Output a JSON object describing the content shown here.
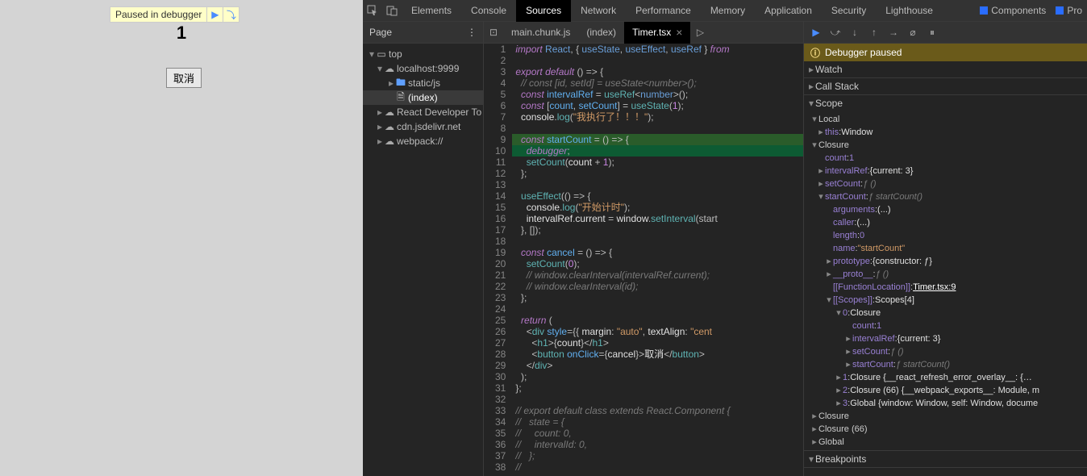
{
  "viewport": {
    "paused_text": "Paused in debugger",
    "counter": "1",
    "cancel_label": "取消"
  },
  "devtools": {
    "tabs": [
      "Elements",
      "Console",
      "Sources",
      "Network",
      "Performance",
      "Memory",
      "Application",
      "Security",
      "Lighthouse"
    ],
    "active_tab": "Sources",
    "extensions": [
      "Components",
      "Pro"
    ]
  },
  "left": {
    "header": "Page",
    "tree": {
      "top": "top",
      "host": "localhost:9999",
      "static": "static/js",
      "index": "(index)",
      "others": [
        "React Developer To",
        "cdn.jsdelivr.net",
        "webpack://"
      ]
    }
  },
  "file_tabs": {
    "items": [
      "main.chunk.js",
      "(index)",
      "Timer.tsx"
    ],
    "active": "Timer.tsx"
  },
  "code": {
    "lines": [
      {
        "n": 1,
        "html": "<span class='tok-keyword'>import</span> <span class='tok-import'>React</span><span class='tok-punct'>, { </span><span class='tok-import'>useState</span><span class='tok-punct'>, </span><span class='tok-import'>useEffect</span><span class='tok-punct'>, </span><span class='tok-import'>useRef</span><span class='tok-punct'> } </span><span class='tok-keyword'>from</span>"
      },
      {
        "n": 2,
        "html": ""
      },
      {
        "n": 3,
        "html": "<span class='tok-keyword'>export</span> <span class='tok-keyword'>default</span> <span class='tok-punct'>() =&gt; {</span>"
      },
      {
        "n": 4,
        "html": "  <span class='tok-comment'>// const [id, setId] = useState&lt;number&gt;();</span>"
      },
      {
        "n": 5,
        "html": "  <span class='tok-keyword'>const</span> <span class='tok-var'>intervalRef</span> <span class='tok-punct'>=</span> <span class='tok-func'>useRef</span><span class='tok-punct'>&lt;</span><span class='tok-type'>number</span><span class='tok-punct'>&gt;();</span>"
      },
      {
        "n": 6,
        "html": "  <span class='tok-keyword'>const</span> <span class='tok-punct'>[</span><span class='tok-var'>count</span><span class='tok-punct'>, </span><span class='tok-var'>setCount</span><span class='tok-punct'>] = </span><span class='tok-func'>useState</span><span class='tok-punct'>(</span><span class='tok-num'>1</span><span class='tok-punct'>);</span>"
      },
      {
        "n": 7,
        "html": "  <span class='tok-default'>console</span><span class='tok-punct'>.</span><span class='tok-func'>log</span><span class='tok-punct'>(</span><span class='tok-string'>\"我执行了！！！\"</span><span class='tok-punct'>);</span>"
      },
      {
        "n": 8,
        "html": ""
      },
      {
        "n": 9,
        "html": "  <span class='tok-keyword'>const</span> <span class='tok-var'>startCount</span> <span class='tok-punct'>= () =&gt; {</span>",
        "cls": "hl-break"
      },
      {
        "n": 10,
        "html": "    <span class='tok-keyword'>debugger</span><span class='tok-punct'>;</span>",
        "cls": "hl-break2"
      },
      {
        "n": 11,
        "html": "    <span class='tok-func'>setCount</span><span class='tok-punct'>(</span><span class='tok-default'>count</span> <span class='tok-punct'>+</span> <span class='tok-num'>1</span><span class='tok-punct'>);</span>"
      },
      {
        "n": 12,
        "html": "  <span class='tok-punct'>};</span>"
      },
      {
        "n": 13,
        "html": ""
      },
      {
        "n": 14,
        "html": "  <span class='tok-func'>useEffect</span><span class='tok-punct'>(() =&gt; {</span>"
      },
      {
        "n": 15,
        "html": "    <span class='tok-default'>console</span><span class='tok-punct'>.</span><span class='tok-func'>log</span><span class='tok-punct'>(</span><span class='tok-string'>\"开始计时\"</span><span class='tok-punct'>);</span>"
      },
      {
        "n": 16,
        "html": "    <span class='tok-default'>intervalRef</span><span class='tok-punct'>.</span><span class='tok-default'>current</span> <span class='tok-punct'>=</span> <span class='tok-default'>window</span><span class='tok-punct'>.</span><span class='tok-func'>setInterval</span><span class='tok-punct'>(start</span>"
      },
      {
        "n": 17,
        "html": "  <span class='tok-punct'>}, []);</span>"
      },
      {
        "n": 18,
        "html": ""
      },
      {
        "n": 19,
        "html": "  <span class='tok-keyword'>const</span> <span class='tok-var'>cancel</span> <span class='tok-punct'>= () =&gt; {</span>"
      },
      {
        "n": 20,
        "html": "    <span class='tok-func'>setCount</span><span class='tok-punct'>(</span><span class='tok-num'>0</span><span class='tok-punct'>);</span>"
      },
      {
        "n": 21,
        "html": "    <span class='tok-comment'>// window.clearInterval(intervalRef.current);</span>"
      },
      {
        "n": 22,
        "html": "    <span class='tok-comment'>// window.clearInterval(id);</span>"
      },
      {
        "n": 23,
        "html": "  <span class='tok-punct'>};</span>"
      },
      {
        "n": 24,
        "html": ""
      },
      {
        "n": 25,
        "html": "  <span class='tok-keyword'>return</span> <span class='tok-punct'>(</span>"
      },
      {
        "n": 26,
        "html": "    <span class='tok-punct'>&lt;</span><span class='tok-tag'>div</span> <span class='tok-attr'>style</span><span class='tok-punct'>={{ </span><span class='tok-default'>margin</span><span class='tok-punct'>: </span><span class='tok-string'>\"auto\"</span><span class='tok-punct'>, </span><span class='tok-default'>textAlign</span><span class='tok-punct'>: </span><span class='tok-string'>\"cent</span>"
      },
      {
        "n": 27,
        "html": "      <span class='tok-punct'>&lt;</span><span class='tok-tag'>h1</span><span class='tok-punct'>&gt;{</span><span class='tok-default'>count</span><span class='tok-punct'>}&lt;/</span><span class='tok-tag'>h1</span><span class='tok-punct'>&gt;</span>"
      },
      {
        "n": 28,
        "html": "      <span class='tok-punct'>&lt;</span><span class='tok-tag'>button</span> <span class='tok-attr'>onClick</span><span class='tok-punct'>={</span><span class='tok-default'>cancel</span><span class='tok-punct'>}&gt;</span><span class='tok-default'>取消</span><span class='tok-punct'>&lt;/</span><span class='tok-tag'>button</span><span class='tok-punct'>&gt;</span>"
      },
      {
        "n": 29,
        "html": "    <span class='tok-punct'>&lt;/</span><span class='tok-tag'>div</span><span class='tok-punct'>&gt;</span>"
      },
      {
        "n": 30,
        "html": "  <span class='tok-punct'>);</span>"
      },
      {
        "n": 31,
        "html": "<span class='tok-punct'>};</span>"
      },
      {
        "n": 32,
        "html": ""
      },
      {
        "n": 33,
        "html": "<span class='tok-comment'>// export default class extends React.Component {</span>"
      },
      {
        "n": 34,
        "html": "<span class='tok-comment'>//   state = {</span>"
      },
      {
        "n": 35,
        "html": "<span class='tok-comment'>//     count: 0,</span>"
      },
      {
        "n": 36,
        "html": "<span class='tok-comment'>//     intervalId: 0,</span>"
      },
      {
        "n": 37,
        "html": "<span class='tok-comment'>//   };</span>"
      },
      {
        "n": 38,
        "html": "<span class='tok-comment'>//</span>"
      }
    ]
  },
  "debugger": {
    "banner": "Debugger paused",
    "sections": {
      "watch": "Watch",
      "callstack": "Call Stack",
      "scope": "Scope",
      "breakpoints": "Breakpoints"
    },
    "scope": {
      "local": "Local",
      "this_key": "this",
      "this_val": "Window",
      "closure": "Closure",
      "count_key": "count",
      "count_val": "1",
      "intervalRef_key": "intervalRef",
      "intervalRef_val": "{current: 3}",
      "setCount_key": "setCount",
      "setCount_val": "ƒ ()",
      "startCount_key": "startCount",
      "startCount_val": "ƒ startCount()",
      "arguments_key": "arguments",
      "arguments_val": "(...)",
      "caller_key": "caller",
      "caller_val": "(...)",
      "length_key": "length",
      "length_val": "0",
      "name_key": "name",
      "name_val": "\"startCount\"",
      "prototype_key": "prototype",
      "prototype_val": "{constructor: ƒ}",
      "proto_key": "__proto__",
      "proto_val": "ƒ ()",
      "funcloc_key": "[[FunctionLocation]]",
      "funcloc_val": "Timer.tsx:9",
      "scopes_key": "[[Scopes]]",
      "scopes_val": "Scopes[4]",
      "s0_key": "0",
      "s0_val": "Closure",
      "s0_count_key": "count",
      "s0_count_val": "1",
      "s0_intervalRef_key": "intervalRef",
      "s0_intervalRef_val": "{current: 3}",
      "s0_setCount_key": "setCount",
      "s0_setCount_val": "ƒ ()",
      "s0_startCount_key": "startCount",
      "s0_startCount_val": "ƒ startCount()",
      "s1_key": "1",
      "s1_val": "Closure {__react_refresh_error_overlay__: {…",
      "s2_key": "2",
      "s2_val": "Closure (66) {__webpack_exports__: Module, m",
      "s3_key": "3",
      "s3_val": "Global {window: Window, self: Window, docume",
      "closure2": "Closure",
      "closure66": "Closure (66)",
      "global": "Global"
    }
  }
}
